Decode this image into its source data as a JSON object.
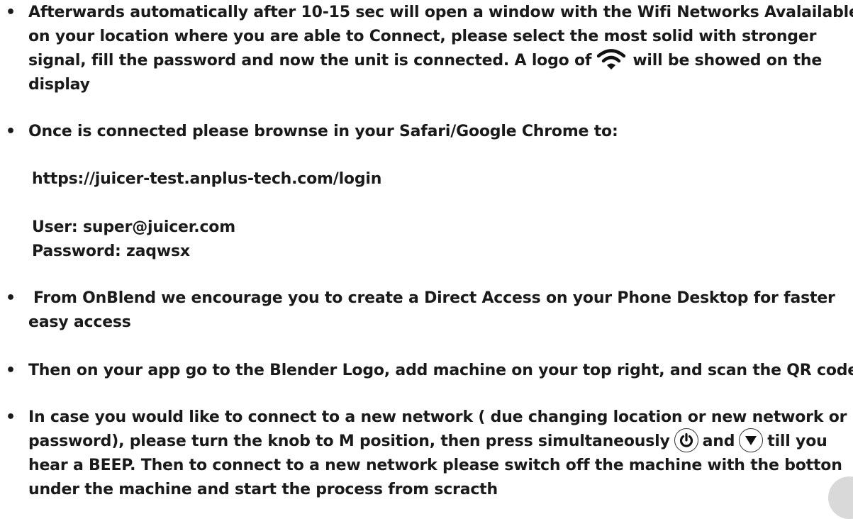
{
  "items": [
    {
      "lines": [
        "Afterwards automatically after 10-15 sec will open a window with the Wifi Networks Avalailable",
        "on your location where you are able to Connect, please select the most solid with stronger",
        "display"
      ],
      "line3_before": "signal, fill the password and now the unit is connected. A logo of",
      "line3_after": "will be showed on the"
    },
    {
      "text": "Once is connected please brownse in your Safari/Google Chrome to:",
      "url": "https://juicer-test.anplus-tech.com/login",
      "user": "User: super@juicer.com",
      "password": "Password: zaqwsx"
    },
    {
      "line1": "From OnBlend we encourage you to create a Direct Access on your Phone Desktop for faster",
      "line2": "easy access"
    },
    {
      "text": "Then on your app go to the Blender Logo, add machine on your top right, and scan the QR code"
    },
    {
      "line1": "In case you would like to connect to a new network ( due changing location or new network or",
      "line2_before": "password), please turn the knob to M position, then press simultaneously",
      "line2_mid": "and",
      "line2_after": "till you",
      "line3": "hear a BEEP. Then to connect to a new network please switch off the machine with the botton",
      "line4": "under the machine and start the process from scracth"
    }
  ],
  "icons": {
    "wifi": "wifi-icon",
    "power": "power-icon",
    "down": "down-arrow-icon"
  }
}
